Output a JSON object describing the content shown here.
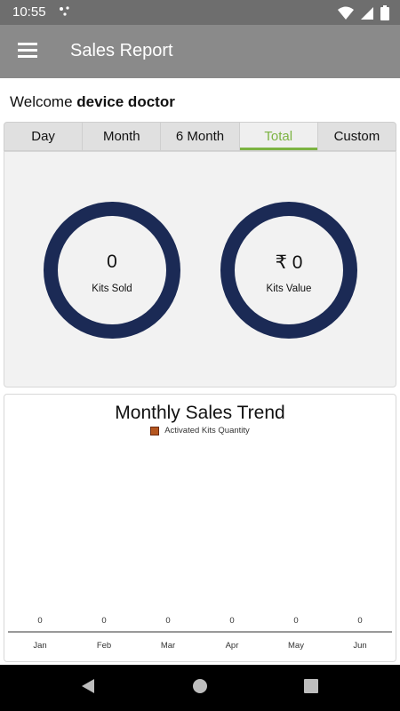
{
  "status_bar": {
    "time": "10:55"
  },
  "app_bar": {
    "title": "Sales Report"
  },
  "welcome": {
    "prefix": "Welcome",
    "user": "device doctor"
  },
  "tabs": [
    {
      "label": "Day",
      "active": false
    },
    {
      "label": "Month",
      "active": false
    },
    {
      "label": "6 Month",
      "active": false
    },
    {
      "label": "Total",
      "active": true
    },
    {
      "label": "Custom",
      "active": false
    }
  ],
  "kpis": {
    "kits_sold": {
      "value": "0",
      "label": "Kits Sold"
    },
    "kits_value": {
      "value": "₹ 0",
      "label": "Kits Value"
    }
  },
  "colors": {
    "accent": "#7cb342",
    "ring": "#1b2a55",
    "bar": "#b5561f"
  },
  "chart_data": {
    "type": "bar",
    "title": "Monthly Sales Trend",
    "categories": [
      "Jan",
      "Feb",
      "Mar",
      "Apr",
      "May",
      "Jun"
    ],
    "series": [
      {
        "name": "Activated Kits Quantity",
        "values": [
          0,
          0,
          0,
          0,
          0,
          0
        ]
      }
    ],
    "xlabel": "",
    "ylabel": "",
    "legend_position": "top",
    "grid": false
  }
}
